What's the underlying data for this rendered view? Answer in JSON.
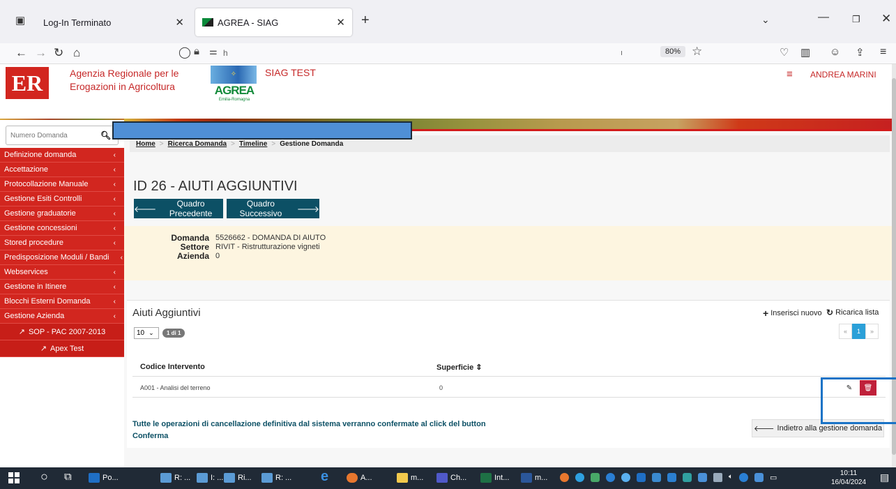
{
  "browser": {
    "tabs": [
      {
        "label": "Log-In Terminato"
      },
      {
        "label": "AGREA - SIAG"
      }
    ],
    "new_tab": "+",
    "url": "h",
    "url_hint": "ı",
    "zoom": "80%"
  },
  "header": {
    "logo_text": "ER",
    "org_line1": "Agenzia Regionale per le",
    "org_line2": "Erogazioni in Agricoltura",
    "agrea_logo": "AGREA",
    "agrea_sub": "Emilia-Romagna",
    "env_label": "SIAG TEST",
    "user_name": "ANDREA MARINI"
  },
  "sidebar": {
    "search_placeholder": "Numero Domanda",
    "items": [
      {
        "label": "Definizione domanda"
      },
      {
        "label": "Accettazione"
      },
      {
        "label": "Protocollazione Manuale"
      },
      {
        "label": "Gestione Esiti Controlli"
      },
      {
        "label": "Gestione graduatorie"
      },
      {
        "label": "Gestione concessioni"
      },
      {
        "label": "Stored procedure"
      },
      {
        "label": "Predisposizione Moduli / Bandi"
      },
      {
        "label": "Webservices"
      },
      {
        "label": "Gestione in Itinere"
      },
      {
        "label": "Blocchi Esterni Domanda"
      },
      {
        "label": "Gestione Azienda"
      }
    ],
    "sub_items": [
      {
        "label": "SOP - PAC 2007-2013"
      },
      {
        "label": "Apex Test"
      }
    ]
  },
  "breadcrumb": {
    "home": "Home",
    "ricerca": "Ricerca Domanda",
    "timeline": "Timeline",
    "current": "Gestione Domanda"
  },
  "page": {
    "title": "ID 26 - AIUTI AGGIUNTIVI",
    "prev_label": "Quadro Precedente",
    "next_label": "Quadro Successivo"
  },
  "info": {
    "domanda_label": "Domanda",
    "domanda_value": "5526662 - DOMANDA DI AIUTO",
    "settore_label": "Settore",
    "settore_value": "RIVIT - Ristrutturazione vigneti",
    "azienda_label": "Azienda",
    "azienda_value": "0"
  },
  "table": {
    "title": "Aiuti Aggiuntivi",
    "add_label": "Inserisci nuovo",
    "reload_label": "Ricarica lista",
    "page_size": "10",
    "page_badge": "1 di 1",
    "pager": [
      "«",
      "1",
      "»"
    ],
    "columns": [
      "Codice Intervento",
      "Superficie ⇕"
    ],
    "rows": [
      {
        "codice": "A001 - Analisi del terreno",
        "superficie": "0"
      }
    ]
  },
  "footer": {
    "note": "Tutte le operazioni di cancellazione definitiva dal sistema verranno confermate al click del button Conferma",
    "back_label": "Indietro alla gestione domanda"
  },
  "taskbar": {
    "items": [
      {
        "label": "Po...",
        "color": "#1f6fc5"
      },
      {
        "label": "R: ...",
        "color": "#5b9bd5"
      },
      {
        "label": "I: ...",
        "color": "#5b9bd5"
      },
      {
        "label": "Ri...",
        "color": "#5b9bd5"
      },
      {
        "label": "R: ...",
        "color": "#5b9bd5"
      },
      {
        "label": "A...",
        "color": "#e8772e"
      },
      {
        "label": "m...",
        "color": "#f2c94c"
      },
      {
        "label": "Ch...",
        "color": "#5059c9"
      },
      {
        "label": "Int...",
        "color": "#1e7145"
      },
      {
        "label": "m...",
        "color": "#2b579a"
      }
    ],
    "time": "10:11",
    "date": "16/04/2024"
  },
  "colors": {
    "accent_red": "#d2261f",
    "accent_blue": "#0c5065",
    "info_bg": "#fdf5e0"
  }
}
